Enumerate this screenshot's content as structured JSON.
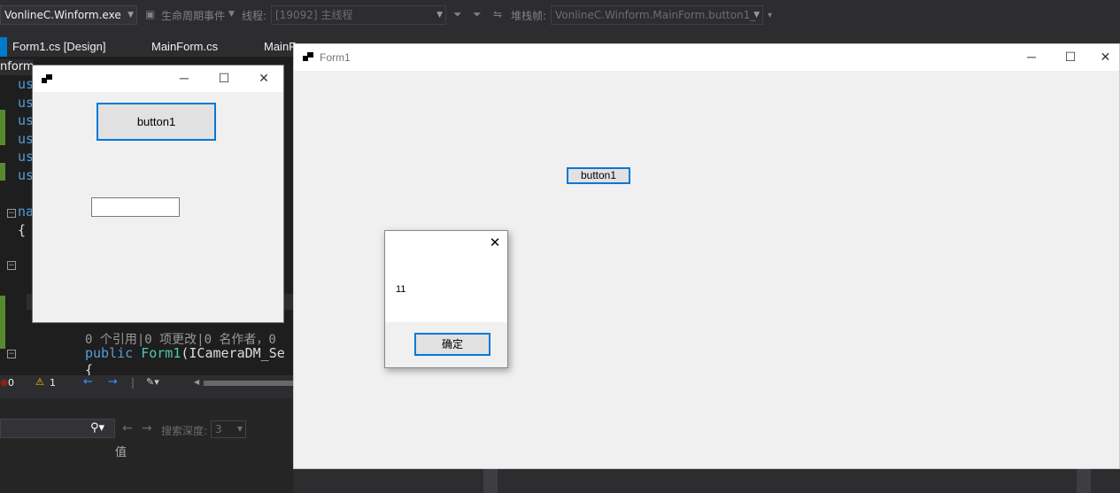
{
  "toolbar": {
    "process": "VonlineC.Winform.exe",
    "lifecycle": "生命周期事件",
    "thread_label": "线程:",
    "thread_value": "[19092] 主线程",
    "stack_label": "堆栈帧:",
    "stack_value": "VonlineC.Winform.MainForm.button1_"
  },
  "tabs": {
    "active": "Form1.cs [Design]",
    "second": "MainForm.cs",
    "third": "MainF"
  },
  "editor": {
    "project_label": "nform",
    "using_kw": "us",
    "namespace_kw": "na",
    "brace": "{",
    "lens": "0 个引用|0 项更改|0 名作者，0",
    "ctor_public": "public",
    "ctor_name": "Form1",
    "ctor_args": "(ICameraDM_Se",
    "brace2": "{"
  },
  "status": {
    "errors": "0",
    "warnings": "1"
  },
  "watch_panel": {
    "search_depth_label": "搜索深度:",
    "search_depth_value": "3",
    "column_value": "值"
  },
  "design_form": {
    "button_label": "button1"
  },
  "runtime_form": {
    "title": "Form1",
    "button_label": "button1"
  },
  "message_box": {
    "message": "11",
    "ok_label": "确定"
  }
}
